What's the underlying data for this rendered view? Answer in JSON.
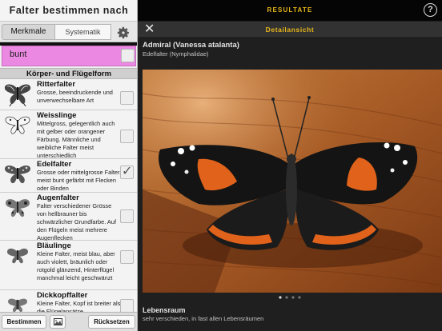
{
  "left_panel": {
    "title": "Falter bestimmen nach",
    "segments": {
      "merkmale": "Merkmale",
      "systematik": "Systematik"
    },
    "settings_icon": "gear-icon",
    "color_filter": {
      "label": "bunt",
      "swatch_color": "#ea88e2",
      "checked": false
    },
    "section_title": "Körper- und Flügelform",
    "items": [
      {
        "name": "Ritterfalter",
        "description": "Grosse, beeindruckende und unverwechselbare Art",
        "checked": false
      },
      {
        "name": "Weisslinge",
        "description": "Mittelgross, gelegentlich auch mit gelber oder orangener Färbung. Männliche und weibliche Falter meist unterschiedlich",
        "checked": false
      },
      {
        "name": "Edelfalter",
        "description": "Grosse oder mittelgrosse Falter, meist bunt gefärbt mit Flecken oder Binden",
        "checked": true
      },
      {
        "name": "Augenfalter",
        "description": "Falter verschiedener Grösse von hellbrauner bis schwärzlicher Grundfarbe. Auf den Flügeln meist mehrere Augenflecken",
        "checked": false
      },
      {
        "name": "Bläulinge",
        "description": "Kleine Falter, meist blau, aber auch violett, bräunlich oder rotgold glänzend, Hinterflügel manchmal leicht geschwänzt",
        "checked": false
      },
      {
        "name": "Dickkopffalter",
        "description": "Kleine Falter, Kopf ist breiter als die Flügelansätze",
        "checked": false
      }
    ],
    "buttons": {
      "bestimmen": "Bestimmen",
      "image_icon": "image-icon",
      "reset": "Rücksetzen"
    }
  },
  "right_panel": {
    "title": "RESULTATE",
    "help_label": "?",
    "detail_title": "Detailansicht",
    "close_label": "✕",
    "species": "Admiral (Vanessa atalanta)",
    "family": "Edelfalter (Nymphalidae)",
    "photo_subject": "admiral-butterfly-photo",
    "pager": {
      "pages": 4,
      "current": 1
    },
    "lebensraum_title": "Lebensraum",
    "lebensraum_text": "sehr verschieden, in fast allen Lebensräumen"
  },
  "colors": {
    "accent": "#e8b91a",
    "bunt": "#ea88e2",
    "dark_bg": "#1f1f1f"
  }
}
